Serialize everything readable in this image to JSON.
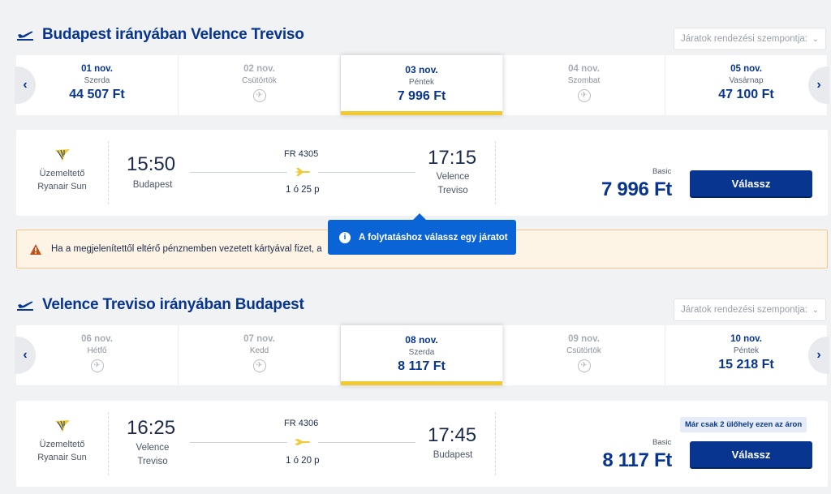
{
  "outbound": {
    "title": "Budapest irányában Velence Treviso",
    "sort_placeholder": "Járatok rendezési szempontja:",
    "dates": [
      {
        "date": "01 nov.",
        "weekday": "Szerda",
        "price": "44 507 Ft",
        "status": "available"
      },
      {
        "date": "02 nov.",
        "weekday": "Csütörtök",
        "price": "",
        "status": "no-flight"
      },
      {
        "date": "03 nov.",
        "weekday": "Péntek",
        "price": "7 996 Ft",
        "status": "selected"
      },
      {
        "date": "04 nov.",
        "weekday": "Szombat",
        "price": "",
        "status": "no-flight"
      },
      {
        "date": "05 nov.",
        "weekday": "Vasárnap",
        "price": "47 100 Ft",
        "status": "available"
      }
    ],
    "flight": {
      "operator_label": "Üzemeltető",
      "operator_name": "Ryanair Sun",
      "dep_time": "15:50",
      "dep_city": "Budapest",
      "flight_no": "FR 4305",
      "duration": "1 ó 25 p",
      "arr_time": "17:15",
      "arr_city": "Velence Treviso",
      "fare_label": "Basic",
      "price": "7 996 Ft",
      "select_label": "Válassz"
    }
  },
  "warning": {
    "text": "Ha a megjelenítettől eltérő pénznemben vezetett kártyával fizet, a"
  },
  "tooltip": {
    "text": "A folytatáshoz válassz egy járatot"
  },
  "inbound": {
    "title": "Velence Treviso irányában Budapest",
    "sort_placeholder": "Járatok rendezési szempontja:",
    "dates": [
      {
        "date": "06 nov.",
        "weekday": "Hétfő",
        "price": "",
        "status": "no-flight"
      },
      {
        "date": "07 nov.",
        "weekday": "Kedd",
        "price": "",
        "status": "no-flight"
      },
      {
        "date": "08 nov.",
        "weekday": "Szerda",
        "price": "8 117 Ft",
        "status": "selected"
      },
      {
        "date": "09 nov.",
        "weekday": "Csütörtök",
        "price": "",
        "status": "no-flight"
      },
      {
        "date": "10 nov.",
        "weekday": "Péntek",
        "price": "15 218 Ft",
        "status": "available"
      }
    ],
    "flight": {
      "operator_label": "Üzemeltető",
      "operator_name": "Ryanair Sun",
      "dep_time": "16:25",
      "dep_city": "Velence Treviso",
      "flight_no": "FR 4306",
      "duration": "1 ó 20 p",
      "arr_time": "17:45",
      "arr_city": "Budapest",
      "seats_badge": "Már csak 2 ülőhely ezen az áron",
      "fare_label": "Basic",
      "price": "8 117 Ft",
      "select_label": "Válassz"
    }
  },
  "colors": {
    "brand_blue": "#073590",
    "accent_yellow": "#f1c933",
    "tooltip_blue": "#0a64d6",
    "warning_bg": "#fdf4e6"
  }
}
